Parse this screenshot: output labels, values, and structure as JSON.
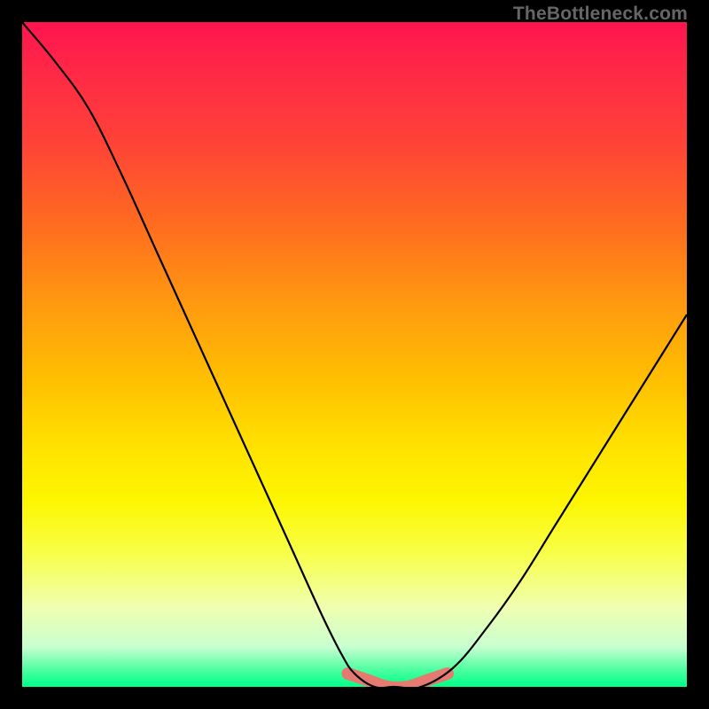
{
  "watermark": "TheBottleneck.com",
  "colors": {
    "background": "#000000",
    "curve": "#000000",
    "salmon_band": "#e47a70"
  },
  "chart_data": {
    "type": "line",
    "title": "",
    "xlabel": "",
    "ylabel": "",
    "xlim": [
      0,
      100
    ],
    "ylim": [
      0,
      100
    ],
    "grid": false,
    "legend": false,
    "series": [
      {
        "name": "bottleneck-curve",
        "x": [
          0,
          5,
          10,
          15,
          20,
          25,
          30,
          35,
          40,
          45,
          48,
          50,
          53,
          56,
          60,
          65,
          70,
          75,
          80,
          85,
          90,
          95,
          100
        ],
        "y": [
          100,
          94,
          87,
          77,
          66,
          55,
          44,
          33,
          22,
          11,
          5,
          2,
          0,
          0,
          0,
          3,
          9,
          16,
          24,
          32,
          40,
          48,
          56
        ]
      },
      {
        "name": "optimal-band",
        "x": [
          49,
          52,
          55,
          58,
          61,
          64
        ],
        "y": [
          2,
          1,
          0,
          0,
          1,
          2
        ]
      }
    ],
    "annotations": []
  }
}
